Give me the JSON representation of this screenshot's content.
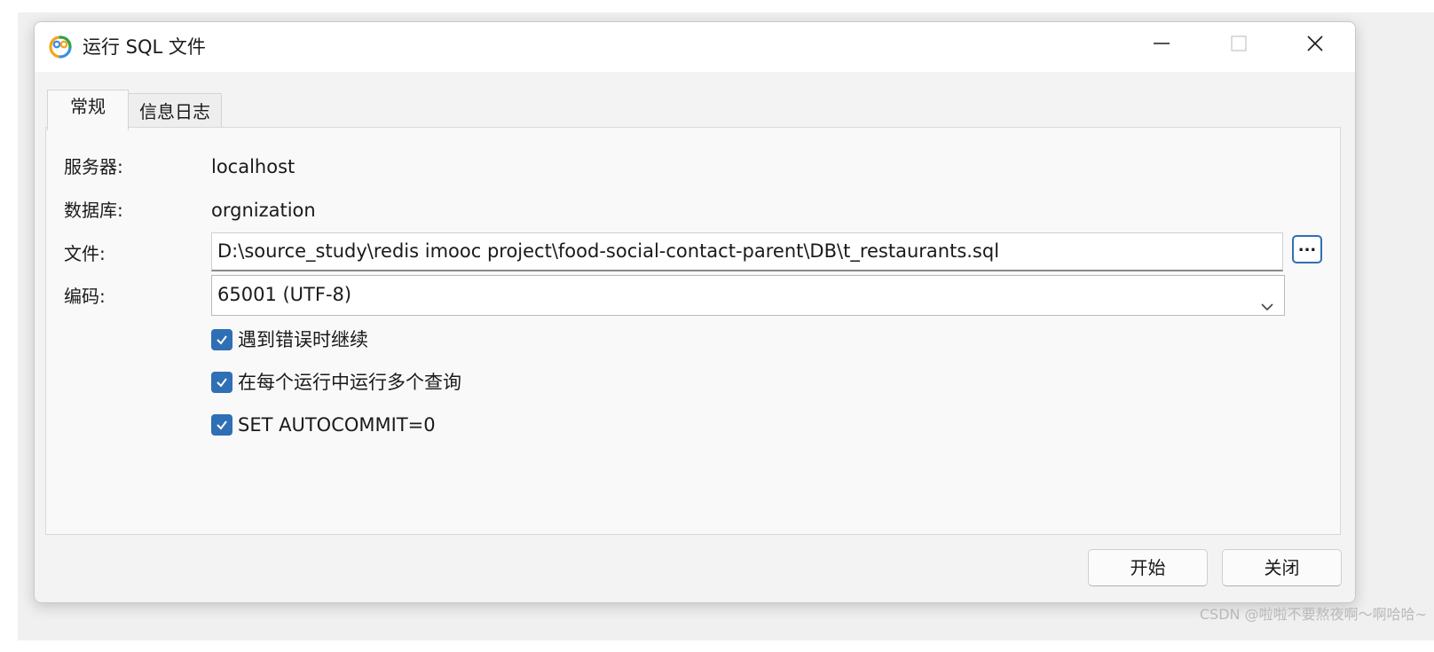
{
  "window": {
    "title": "运行 SQL 文件",
    "controls": {
      "minimize": "minimize-icon",
      "maximize": "maximize-icon",
      "close": "close-icon"
    }
  },
  "tabs": [
    {
      "label": "常规",
      "active": true
    },
    {
      "label": "信息日志",
      "active": false
    }
  ],
  "form": {
    "server_label": "服务器:",
    "server_value": "localhost",
    "database_label": "数据库:",
    "database_value": "orgnization",
    "file_label": "文件:",
    "file_value": "D:\\source_study\\redis imooc project\\food-social-contact-parent\\DB\\t_restaurants.sql",
    "browse_label": "...",
    "encoding_label": "编码:",
    "encoding_value": "65001 (UTF-8)"
  },
  "options": [
    {
      "label": "遇到错误时继续",
      "checked": true
    },
    {
      "label": "在每个运行中运行多个查询",
      "checked": true
    },
    {
      "label": "SET AUTOCOMMIT=0",
      "checked": true
    }
  ],
  "buttons": {
    "start": "开始",
    "close": "关闭"
  },
  "watermark": "CSDN @啦啦不要熬夜啊～啊哈哈~",
  "colors": {
    "accent": "#2f6fb5",
    "window_bg": "#f3f3f3",
    "panel_bg": "#f9f9f9"
  }
}
